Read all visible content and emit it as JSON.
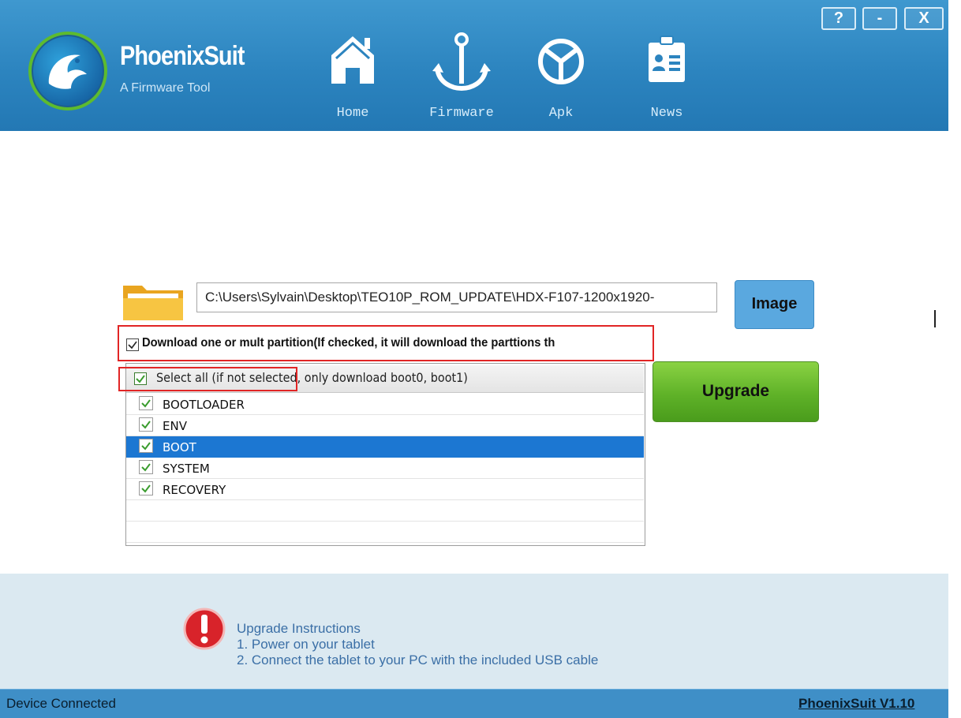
{
  "header": {
    "app_name": "PhoenixSuit",
    "app_subtitle": "A Firmware Tool",
    "nav": [
      {
        "label": "Home",
        "icon": "home-icon"
      },
      {
        "label": "Firmware",
        "icon": "anchor-icon"
      },
      {
        "label": "Apk",
        "icon": "apk-icon"
      },
      {
        "label": "News",
        "icon": "news-icon"
      }
    ],
    "window_buttons": {
      "help": "?",
      "minimize": "-",
      "close": "X"
    }
  },
  "firmware": {
    "image_path": "C:\\Users\\Sylvain\\Desktop\\TEO10P_ROM_UPDATE\\HDX-F107-1200x1920-",
    "image_button": "Image",
    "download_partition_label": "Download one or mult partition(If checked, it will download the parttions th",
    "download_partition_checked": true,
    "select_all_label": "Select all (if not selected, only download boot0, boot1)",
    "select_all_checked": true,
    "partitions": [
      {
        "name": "BOOTLOADER",
        "checked": true,
        "selected": false
      },
      {
        "name": "ENV",
        "checked": true,
        "selected": false
      },
      {
        "name": "BOOT",
        "checked": true,
        "selected": true
      },
      {
        "name": "SYSTEM",
        "checked": true,
        "selected": false
      },
      {
        "name": "RECOVERY",
        "checked": true,
        "selected": false
      }
    ],
    "upgrade_button": "Upgrade"
  },
  "instructions": {
    "title": "Upgrade Instructions",
    "step1": "1. Power on your tablet",
    "step2": "2. Connect the tablet to your PC with the included USB cable"
  },
  "status_bar": {
    "status": "Device Connected",
    "version": "PhoenixSuit V1.10"
  },
  "colors": {
    "header_blue": "#2c84bf",
    "upgrade_green": "#5fb228",
    "selection_blue": "#1c77d2",
    "highlight_red": "#e12525"
  }
}
